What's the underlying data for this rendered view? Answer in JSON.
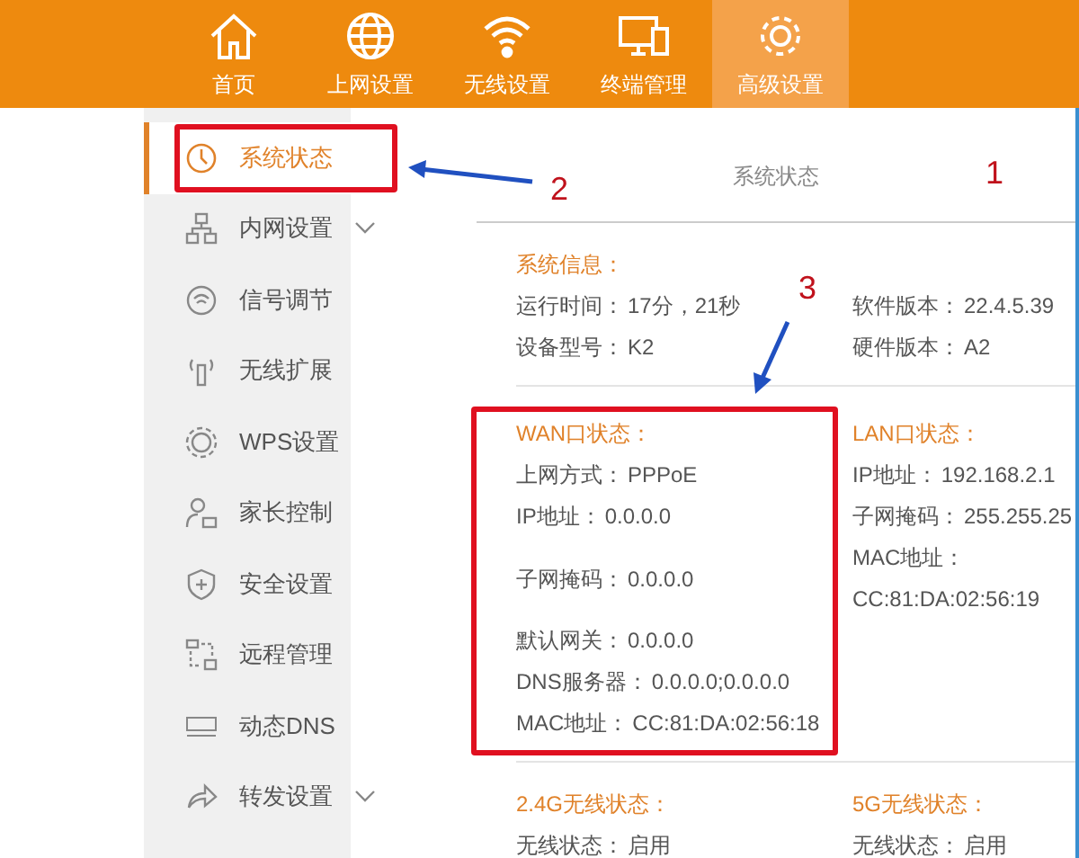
{
  "top_nav": [
    {
      "label": "首页",
      "selected": false
    },
    {
      "label": "上网设置",
      "selected": false
    },
    {
      "label": "无线设置",
      "selected": false
    },
    {
      "label": "终端管理",
      "selected": false
    },
    {
      "label": "高级设置",
      "selected": true
    }
  ],
  "sidebar": {
    "items": [
      {
        "label": "系统状态",
        "kind": "link",
        "selected": true
      },
      {
        "label": "内网设置",
        "kind": "group",
        "selected": false
      },
      {
        "label": "信号调节",
        "kind": "link",
        "selected": false
      },
      {
        "label": "无线扩展",
        "kind": "link",
        "selected": false
      },
      {
        "label": "WPS设置",
        "kind": "link",
        "selected": false
      },
      {
        "label": "家长控制",
        "kind": "link",
        "selected": false
      },
      {
        "label": "安全设置",
        "kind": "link",
        "selected": false
      },
      {
        "label": "远程管理",
        "kind": "link",
        "selected": false
      },
      {
        "label": "动态DNS",
        "kind": "link",
        "selected": false
      },
      {
        "label": "转发设置",
        "kind": "group",
        "selected": false
      }
    ]
  },
  "page_title": "系统状态",
  "sections": [
    {
      "left_heading": "系统信息：",
      "rows": [
        {
          "left": {
            "label": "运行时间：",
            "value": "17分，21秒"
          },
          "right": {
            "label": "软件版本：",
            "value": "22.4.5.39"
          }
        },
        {
          "left": {
            "label": "设备型号：",
            "value": "K2"
          },
          "right": {
            "label": "硬件版本：",
            "value": "A2"
          }
        }
      ]
    },
    {
      "left_heading": "WAN口状态：",
      "right_heading": "LAN口状态：",
      "rows": [
        {
          "left": {
            "label": "上网方式：",
            "value": "PPPoE"
          },
          "right": {
            "label": "IP地址：",
            "value": "192.168.2.1"
          }
        },
        {
          "left": {
            "label": "IP地址：",
            "value": "0.0.0.0"
          },
          "right": {
            "label": "子网掩码：",
            "value": "255.255.25"
          }
        },
        {
          "left": {
            "label": "子网掩码：",
            "value": "0.0.0.0"
          },
          "right": {
            "label": "MAC地址：",
            "value": "CC:81:DA:02:56:19"
          }
        },
        {
          "left": {
            "label": "默认网关：",
            "value": "0.0.0.0"
          },
          "right": null
        },
        {
          "left": {
            "label": "DNS服务器：",
            "value": "0.0.0.0;0.0.0.0"
          },
          "right": null
        },
        {
          "left": {
            "label": "MAC地址：",
            "value": "CC:81:DA:02:56:18"
          },
          "right": null
        }
      ]
    },
    {
      "left_heading": "2.4G无线状态：",
      "right_heading": "5G无线状态：",
      "rows": [
        {
          "left": {
            "label": "无线状态：",
            "value": "启用"
          },
          "right": {
            "label": "无线状态：",
            "value": "启用"
          }
        }
      ]
    }
  ],
  "annotations": [
    {
      "label": "1"
    },
    {
      "label": "2"
    },
    {
      "label": "3"
    }
  ]
}
